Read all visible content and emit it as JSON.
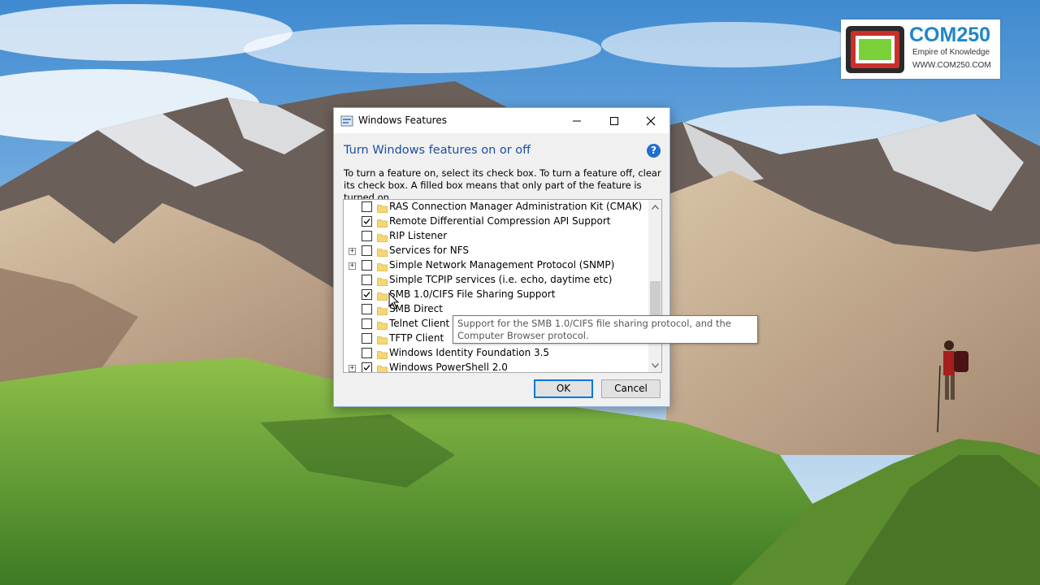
{
  "logo": {
    "brand_a": "COM",
    "brand_b": "250",
    "tagline": "Empire of Knowledge",
    "site": "WWW.COM250.COM"
  },
  "dialog": {
    "title": "Windows Features",
    "heading": "Turn Windows features on or off",
    "description": "To turn a feature on, select its check box. To turn a feature off, clear its check box. A filled box means that only part of the feature is turned on.",
    "features": [
      {
        "label": "RAS Connection Manager Administration Kit (CMAK)",
        "checked": false,
        "expandable": false
      },
      {
        "label": "Remote Differential Compression API Support",
        "checked": true,
        "expandable": false
      },
      {
        "label": "RIP Listener",
        "checked": false,
        "expandable": false
      },
      {
        "label": "Services for NFS",
        "checked": false,
        "expandable": true
      },
      {
        "label": "Simple Network Management Protocol (SNMP)",
        "checked": false,
        "expandable": true
      },
      {
        "label": "Simple TCPIP services (i.e. echo, daytime etc)",
        "checked": false,
        "expandable": false
      },
      {
        "label": "SMB 1.0/CIFS File Sharing Support",
        "checked": true,
        "expandable": false
      },
      {
        "label": "SMB Direct",
        "checked": false,
        "expandable": false
      },
      {
        "label": "Telnet Client",
        "checked": false,
        "expandable": false
      },
      {
        "label": "TFTP Client",
        "checked": false,
        "expandable": false
      },
      {
        "label": "Windows Identity Foundation 3.5",
        "checked": false,
        "expandable": false
      },
      {
        "label": "Windows PowerShell 2.0",
        "checked": true,
        "expandable": true
      }
    ],
    "ok_label": "OK",
    "cancel_label": "Cancel"
  },
  "tooltip": {
    "text": "Support for the SMB 1.0/CIFS file sharing protocol, and the Computer Browser protocol."
  },
  "colors": {
    "heading": "#1c4fa0",
    "accent": "#0078d7",
    "logo_blue": "#1f86c8",
    "logo_red": "#c9302c"
  }
}
